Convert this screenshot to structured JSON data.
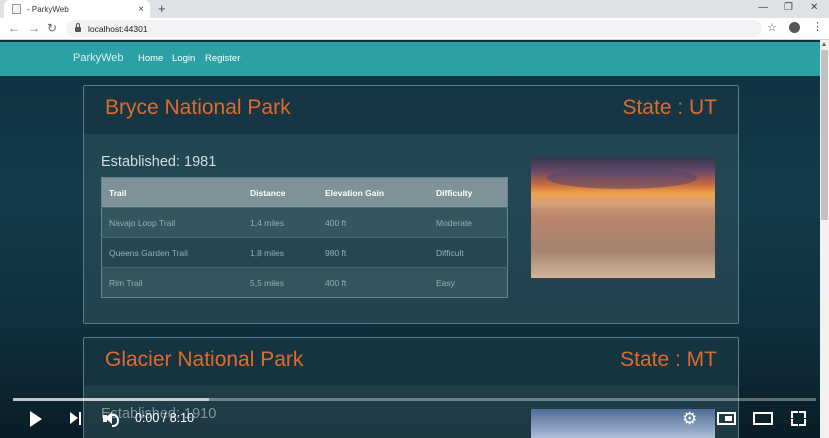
{
  "browser": {
    "tab_title": "- ParkyWeb",
    "tab_close": "×",
    "new_tab": "+",
    "window_controls": {
      "minimize": "—",
      "restore": "❐",
      "close": "✕"
    },
    "nav": {
      "back": "←",
      "forward": "→",
      "reload": "↻"
    },
    "url": "localhost:44301",
    "bookmark_icon": "star-icon",
    "menu_glyph": "⋮"
  },
  "navbar": {
    "brand": "ParkyWeb",
    "links": [
      "Home",
      "Login",
      "Register"
    ],
    "color": "#2ba0a5"
  },
  "parks": [
    {
      "name": "Bryce National Park",
      "state": "State : UT",
      "established": "Established: 1981",
      "table_headers": [
        "Trail",
        "Distance",
        "Elevation Gain",
        "Difficulty"
      ],
      "trails": [
        [
          "Navajo Loop Trail",
          "1,4 miles",
          "400 ft",
          "Moderate"
        ],
        [
          "Queens Garden Trail",
          "1,8 miles",
          "980 ft",
          "Difficult"
        ],
        [
          "Rim Trail",
          "5,5 miles",
          "400 ft",
          "Easy"
        ]
      ]
    },
    {
      "name": "Glacier National Park",
      "state": "State : MT",
      "established": "Established: 1910"
    }
  ],
  "accent_color": "#e06a2c",
  "video": {
    "time": "0:00 / 8:10",
    "settings_glyph": "⚙"
  }
}
